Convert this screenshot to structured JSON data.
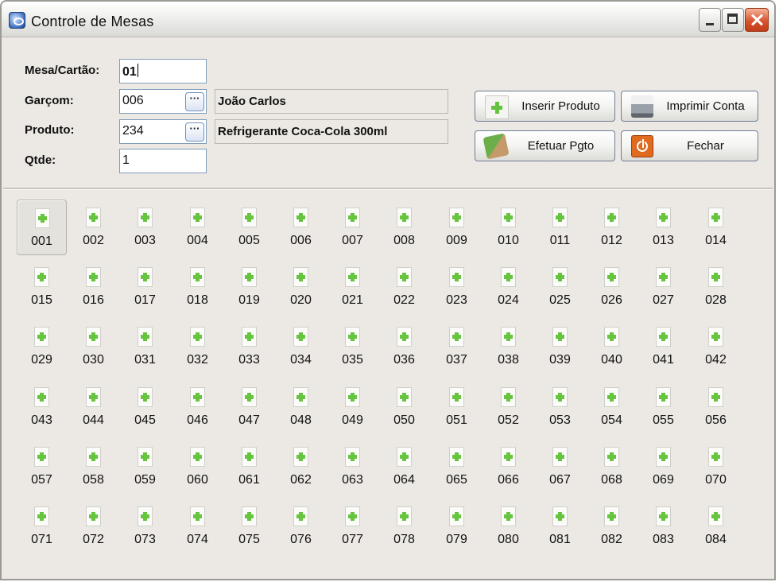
{
  "window": {
    "title": "Controle de Mesas"
  },
  "form": {
    "mesa_label": "Mesa/Cartão:",
    "mesa_value": "01",
    "garcom_label": "Garçom:",
    "garcom_code": "006",
    "garcom_name": "João Carlos",
    "produto_label": "Produto:",
    "produto_code": "234",
    "produto_name": "Refrigerante Coca-Cola 300ml",
    "qtde_label": "Qtde:",
    "qtde_value": "1",
    "lookup_label": "···"
  },
  "actions": {
    "inserir": "Inserir Produto",
    "imprimir": "Imprimir Conta",
    "efetuar": "Efetuar Pgto",
    "fechar": "Fechar"
  },
  "tables": {
    "selected": "001",
    "items": [
      "001",
      "002",
      "003",
      "004",
      "005",
      "006",
      "007",
      "008",
      "009",
      "010",
      "011",
      "012",
      "013",
      "014",
      "015",
      "016",
      "017",
      "018",
      "019",
      "020",
      "021",
      "022",
      "023",
      "024",
      "025",
      "026",
      "027",
      "028",
      "029",
      "030",
      "031",
      "032",
      "033",
      "034",
      "035",
      "036",
      "037",
      "038",
      "039",
      "040",
      "041",
      "042",
      "043",
      "044",
      "045",
      "046",
      "047",
      "048",
      "049",
      "050",
      "051",
      "052",
      "053",
      "054",
      "055",
      "056",
      "057",
      "058",
      "059",
      "060",
      "061",
      "062",
      "063",
      "064",
      "065",
      "066",
      "067",
      "068",
      "069",
      "070",
      "071",
      "072",
      "073",
      "074",
      "075",
      "076",
      "077",
      "078",
      "079",
      "080",
      "081",
      "082",
      "083",
      "084"
    ]
  }
}
